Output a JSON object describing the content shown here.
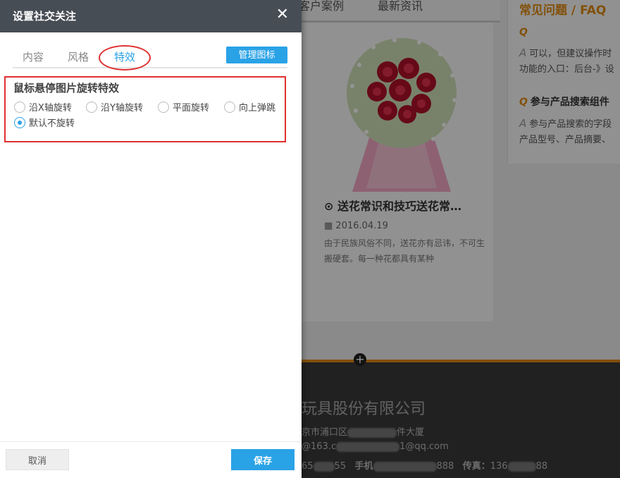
{
  "background_site": {
    "nav_items": [
      "客户案例",
      "最新资讯"
    ],
    "news": {
      "title": "送花常识和技巧送花常…",
      "date": "2016.04.19",
      "text": "由于民族风俗不同，送花亦有忌讳，不可生搬硬套。每一种花都具有某种"
    },
    "faq": {
      "title": "常见问题",
      "title_sep": "/",
      "title_en": "FAQ",
      "items": [
        {
          "q_mark": "Q",
          "question": "",
          "a_mark": "A",
          "answer_lines": [
            "可以，但建议操作时",
            "功能的入口：后台-》设"
          ]
        },
        {
          "q_mark": "Q",
          "question": "参与产品搜索组件",
          "a_mark": "A",
          "answer_lines": [
            "参与产品搜索的字段",
            "产品型号、产品摘要、"
          ]
        }
      ]
    },
    "footer": {
      "company": "玩具股份有限公司",
      "addr_start": "京市浦口区",
      "addr_end": "件大厦",
      "email_start": "@163.c",
      "email_end": "1@qq.com",
      "tel_start": "65",
      "tel_end": "55",
      "mobile_label": "手机",
      "mobile_end": "888",
      "fax_label": "传真：",
      "fax_start": "136",
      "fax_end": "88"
    }
  },
  "dialog": {
    "title": "设置社交关注",
    "close_glyph": "✕",
    "tabs": [
      "内容",
      "风格",
      "特效"
    ],
    "active_tab": "特效",
    "manage_icons_label": "管理图标",
    "effects": {
      "heading": "鼠标悬停图片旋转特效",
      "options": [
        "沿X轴旋转",
        "沿Y轴旋转",
        "平面旋转",
        "向上弹跳",
        "默认不旋转"
      ],
      "selected": "默认不旋转"
    },
    "cancel_label": "取消",
    "save_label": "保存"
  },
  "colors": {
    "accent": "#2aa2e6",
    "highlight": "#e03030",
    "header_bg": "#474d54",
    "faq_orange": "#e08a10"
  }
}
